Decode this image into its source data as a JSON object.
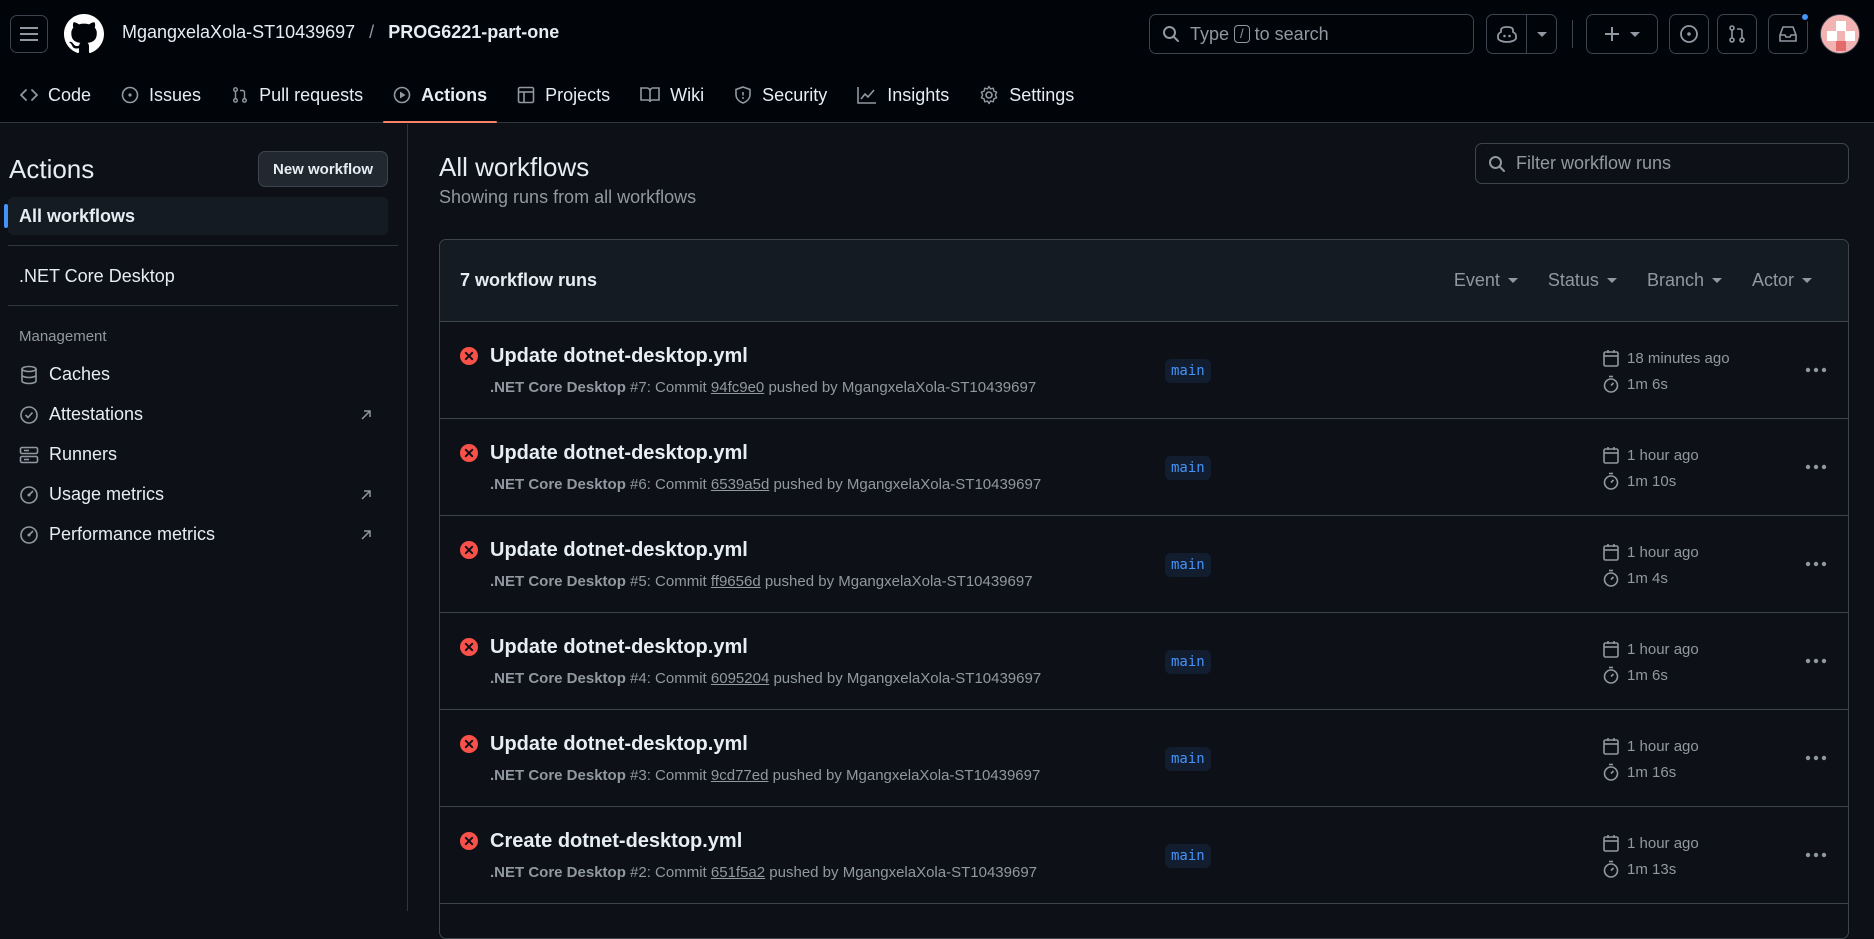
{
  "header": {
    "owner": "MgangxelaXola-ST10439697",
    "separator": "/",
    "repo": "PROG6221-part-one",
    "search_pre": "Type",
    "search_key": "/",
    "search_post": "to search"
  },
  "tabs": [
    {
      "label": "Code",
      "icon": "code-icon"
    },
    {
      "label": "Issues",
      "icon": "issue-icon"
    },
    {
      "label": "Pull requests",
      "icon": "pull-request-icon"
    },
    {
      "label": "Actions",
      "icon": "play-icon"
    },
    {
      "label": "Projects",
      "icon": "table-icon"
    },
    {
      "label": "Wiki",
      "icon": "book-icon"
    },
    {
      "label": "Security",
      "icon": "shield-icon"
    },
    {
      "label": "Insights",
      "icon": "graph-icon"
    },
    {
      "label": "Settings",
      "icon": "gear-icon"
    }
  ],
  "sidebar": {
    "title": "Actions",
    "new_workflow": "New workflow",
    "all_workflows": "All workflows",
    "workflow": ".NET Core Desktop",
    "management_label": "Management",
    "management": [
      {
        "label": "Caches",
        "icon": "database-icon"
      },
      {
        "label": "Attestations",
        "icon": "verified-icon"
      },
      {
        "label": "Runners",
        "icon": "server-icon"
      },
      {
        "label": "Usage metrics",
        "icon": "meter-icon"
      },
      {
        "label": "Performance metrics",
        "icon": "meter-icon"
      }
    ]
  },
  "main": {
    "title": "All workflows",
    "subtitle": "Showing runs from all workflows",
    "filter_placeholder": "Filter workflow runs",
    "runs_count": "7 workflow runs",
    "filters": [
      "Event",
      "Status",
      "Branch",
      "Actor"
    ],
    "runs": [
      {
        "title": "Update dotnet-desktop.yml",
        "workflow": ".NET Core Desktop",
        "number": "#7",
        "sha": "94fc9e0",
        "author": "MgangxelaXola-ST10439697",
        "branch": "main",
        "when": "18 minutes ago",
        "duration": "1m 6s"
      },
      {
        "title": "Update dotnet-desktop.yml",
        "workflow": ".NET Core Desktop",
        "number": "#6",
        "sha": "6539a5d",
        "author": "MgangxelaXola-ST10439697",
        "branch": "main",
        "when": "1 hour ago",
        "duration": "1m 10s"
      },
      {
        "title": "Update dotnet-desktop.yml",
        "workflow": ".NET Core Desktop",
        "number": "#5",
        "sha": "ff9656d",
        "author": "MgangxelaXola-ST10439697",
        "branch": "main",
        "when": "1 hour ago",
        "duration": "1m 4s"
      },
      {
        "title": "Update dotnet-desktop.yml",
        "workflow": ".NET Core Desktop",
        "number": "#4",
        "sha": "6095204",
        "author": "MgangxelaXola-ST10439697",
        "branch": "main",
        "when": "1 hour ago",
        "duration": "1m 6s"
      },
      {
        "title": "Update dotnet-desktop.yml",
        "workflow": ".NET Core Desktop",
        "number": "#3",
        "sha": "9cd77ed",
        "author": "MgangxelaXola-ST10439697",
        "branch": "main",
        "when": "1 hour ago",
        "duration": "1m 16s"
      },
      {
        "title": "Create dotnet-desktop.yml",
        "workflow": ".NET Core Desktop",
        "number": "#2",
        "sha": "651f5a2",
        "author": "MgangxelaXola-ST10439697",
        "branch": "main",
        "when": "1 hour ago",
        "duration": "1m 13s"
      }
    ],
    "run_meta_commit": ": Commit",
    "run_meta_pushed": "pushed by"
  },
  "colors": {
    "bg": "#0d1117",
    "header_bg": "#010409",
    "accent": "#4493f8",
    "active_tab": "#f78166",
    "failure": "#f85149"
  }
}
